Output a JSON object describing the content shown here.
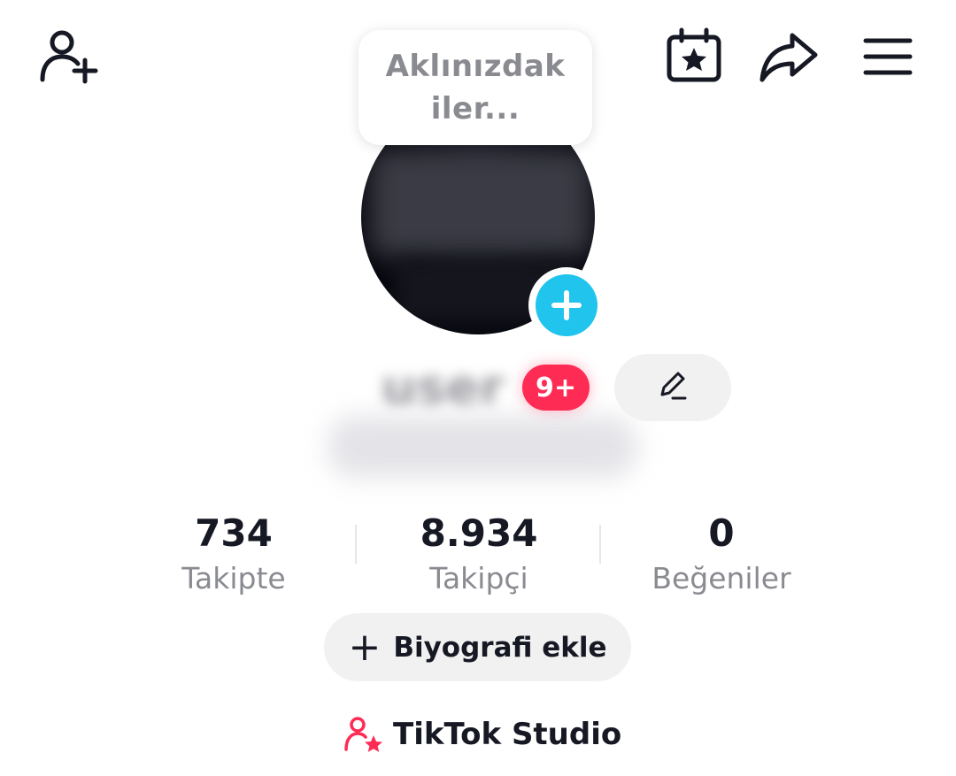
{
  "header": {
    "icons": [
      "add-friend-icon",
      "calendar-star-icon",
      "share-icon",
      "menu-icon"
    ]
  },
  "note": {
    "text": "Aklınızdakiler..."
  },
  "avatar": {
    "add_icon": "plus-icon",
    "add_color": "#20c4ec"
  },
  "profile": {
    "username_obscured": "user",
    "notification_badge": "9+",
    "badge_color": "#fe2c55",
    "edit_icon": "pencil-icon"
  },
  "stats": {
    "following": {
      "value": "734",
      "label": "Takipte"
    },
    "followers": {
      "value": "8.934",
      "label": "Takipçi"
    },
    "likes": {
      "value": "0",
      "label": "Beğeniler"
    }
  },
  "bio_button": {
    "icon": "+",
    "label": "Biyografi ekle"
  },
  "studio": {
    "label": "TikTok Studio",
    "icon": "person-star-icon",
    "icon_color": "#fe2c55"
  }
}
